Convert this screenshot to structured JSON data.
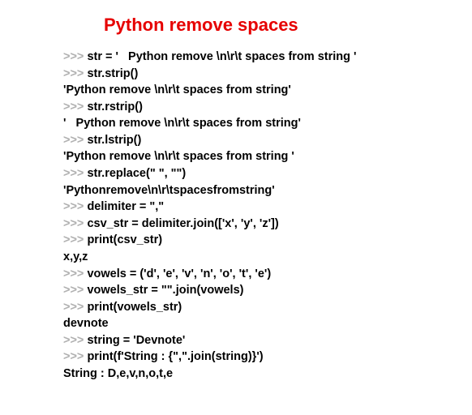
{
  "title": "Python remove spaces",
  "lines": [
    {
      "prompt": ">>> ",
      "text": "str = '   Python remove \\n\\r\\t spaces from string '"
    },
    {
      "prompt": ">>> ",
      "text": "str.strip()"
    },
    {
      "prompt": "",
      "text": "'Python remove \\n\\r\\t spaces from string'"
    },
    {
      "prompt": ">>> ",
      "text": "str.rstrip()"
    },
    {
      "prompt": "",
      "text": "'   Python remove \\n\\r\\t spaces from string'"
    },
    {
      "prompt": ">>> ",
      "text": "str.lstrip()"
    },
    {
      "prompt": "",
      "text": "'Python remove \\n\\r\\t spaces from string '"
    },
    {
      "prompt": ">>> ",
      "text": "str.replace(\" \", \"\")"
    },
    {
      "prompt": "",
      "text": "'Pythonremove\\n\\r\\tspacesfromstring'"
    },
    {
      "prompt": ">>> ",
      "text": "delimiter = \",\""
    },
    {
      "prompt": ">>> ",
      "text": "csv_str = delimiter.join(['x', 'y', 'z'])"
    },
    {
      "prompt": ">>> ",
      "text": "print(csv_str)"
    },
    {
      "prompt": "",
      "text": "x,y,z"
    },
    {
      "prompt": ">>> ",
      "text": "vowels = ('d', 'e', 'v', 'n', 'o', 't', 'e')"
    },
    {
      "prompt": ">>> ",
      "text": "vowels_str = \"\".join(vowels)"
    },
    {
      "prompt": ">>> ",
      "text": "print(vowels_str)"
    },
    {
      "prompt": "",
      "text": "devnote"
    },
    {
      "prompt": ">>> ",
      "text": "string = 'Devnote'"
    },
    {
      "prompt": ">>> ",
      "text": "print(f'String : {\",\".join(string)}')"
    },
    {
      "prompt": "",
      "text": "String : D,e,v,n,o,t,e"
    }
  ]
}
